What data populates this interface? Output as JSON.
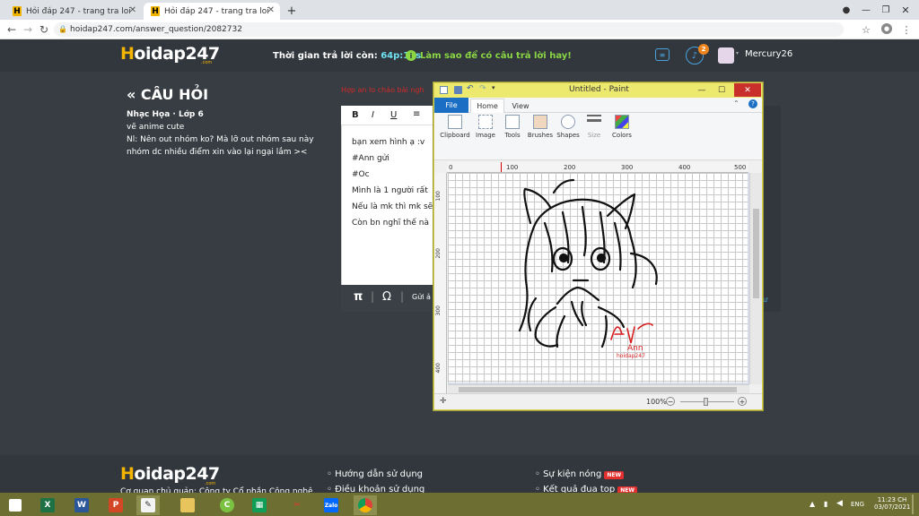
{
  "browser": {
    "tabs": [
      {
        "title": "Hỏi đáp 247 - trang tra loi"
      },
      {
        "title": "Hỏi đáp 247 - trang tra loi"
      }
    ],
    "new_tab": "+",
    "url": "hoidap247.com/answer_question/2082732"
  },
  "site": {
    "logo": "oidap247",
    "logo_first": "H",
    "logo_sub": ".com",
    "timer_label": "Thời gian trả lời còn:",
    "timer_value": "64p:13s",
    "tip": "Làm sao để có câu trả lời hay!",
    "notification_count": "2",
    "username": "Mercury26"
  },
  "question": {
    "back_label": "« CÂU HỎI",
    "subject": "Nhạc Họa · Lớp 6",
    "line1": "vẽ anime cute",
    "line2": "Nl: Nên out nhóm ko? Mà lỡ out nhóm sau này",
    "line3": "nhóm dc nhiều điểm xin vào lại ngại lắm ><",
    "red_hint": "Hợp an lo chảo bài ngh"
  },
  "editor": {
    "toolbar": [
      "B",
      "I",
      "U"
    ],
    "lines": [
      "bạn xem hình ạ :v",
      "#Ann gửi",
      "#Oc",
      "Mình là 1 người rất",
      "Nếu là mk thì mk sẽ",
      "Còn bn nghĩ thế nà"
    ],
    "footer_pi": "π",
    "footer_omega": "Ω",
    "footer_send": "Gửi ả"
  },
  "paint": {
    "title": "Untitled - Paint",
    "menu": [
      "File",
      "Home",
      "View"
    ],
    "groups": [
      "Clipboard",
      "Image",
      "Tools",
      "Brushes",
      "Shapes",
      "Size",
      "Colors"
    ],
    "ruler_marks": [
      "0",
      "100",
      "200",
      "300",
      "400",
      "500"
    ],
    "vruler_marks": [
      "100",
      "200",
      "300",
      "400"
    ],
    "signature": "Ann",
    "signature_sub": "hoidap247",
    "zoom": "100%"
  },
  "footer": {
    "links_left": [
      "Hướng dẫn sử dụng",
      "Điều khoản sử dụng"
    ],
    "links_right": [
      "Sự kiện nóng",
      "Kết quả đua top"
    ],
    "badge": "NEW",
    "company": "Cơ quan chủ quản: Công ty Cổ phần Công nghệ"
  },
  "taskbar": {
    "lang": "ENG",
    "time": "11:23 CH",
    "date": "03/07/2021"
  },
  "colors": {
    "brand": "#f4b400",
    "timer": "#6ee0f0",
    "tip": "#8bd645",
    "paint_title": "#ede96f",
    "taskbar": "#6c6f31"
  }
}
